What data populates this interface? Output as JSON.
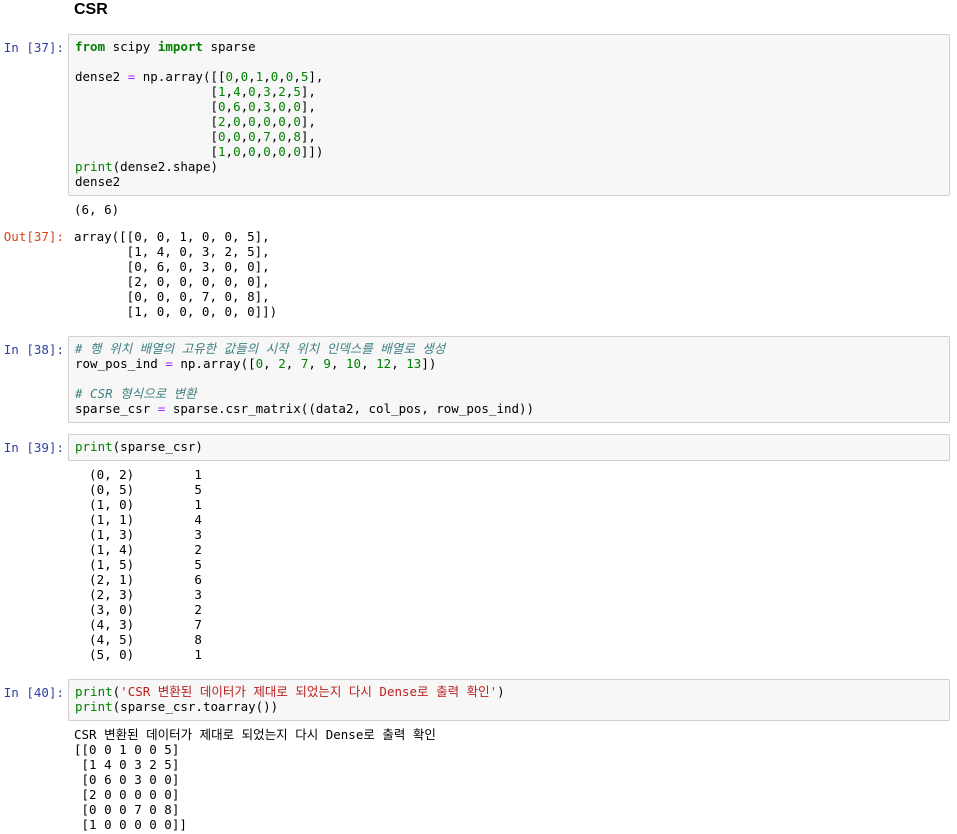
{
  "heading": "CSR",
  "cells": {
    "c37": {
      "in_prompt": "In [37]:",
      "out_prompt": "Out[37]:",
      "code": [
        [
          {
            "t": "from",
            "c": "kw"
          },
          {
            "t": " scipy "
          },
          {
            "t": "import",
            "c": "kw"
          },
          {
            "t": " sparse"
          }
        ],
        [
          {
            "t": ""
          }
        ],
        [
          {
            "t": "dense2 "
          },
          {
            "t": "=",
            "c": "op"
          },
          {
            "t": " np.array([["
          },
          {
            "t": "0",
            "c": "num"
          },
          {
            "t": ","
          },
          {
            "t": "0",
            "c": "num"
          },
          {
            "t": ","
          },
          {
            "t": "1",
            "c": "num"
          },
          {
            "t": ","
          },
          {
            "t": "0",
            "c": "num"
          },
          {
            "t": ","
          },
          {
            "t": "0",
            "c": "num"
          },
          {
            "t": ","
          },
          {
            "t": "5",
            "c": "num"
          },
          {
            "t": "],"
          }
        ],
        [
          {
            "t": "                  ["
          },
          {
            "t": "1",
            "c": "num"
          },
          {
            "t": ","
          },
          {
            "t": "4",
            "c": "num"
          },
          {
            "t": ","
          },
          {
            "t": "0",
            "c": "num"
          },
          {
            "t": ","
          },
          {
            "t": "3",
            "c": "num"
          },
          {
            "t": ","
          },
          {
            "t": "2",
            "c": "num"
          },
          {
            "t": ","
          },
          {
            "t": "5",
            "c": "num"
          },
          {
            "t": "],"
          }
        ],
        [
          {
            "t": "                  ["
          },
          {
            "t": "0",
            "c": "num"
          },
          {
            "t": ","
          },
          {
            "t": "6",
            "c": "num"
          },
          {
            "t": ","
          },
          {
            "t": "0",
            "c": "num"
          },
          {
            "t": ","
          },
          {
            "t": "3",
            "c": "num"
          },
          {
            "t": ","
          },
          {
            "t": "0",
            "c": "num"
          },
          {
            "t": ","
          },
          {
            "t": "0",
            "c": "num"
          },
          {
            "t": "],"
          }
        ],
        [
          {
            "t": "                  ["
          },
          {
            "t": "2",
            "c": "num"
          },
          {
            "t": ","
          },
          {
            "t": "0",
            "c": "num"
          },
          {
            "t": ","
          },
          {
            "t": "0",
            "c": "num"
          },
          {
            "t": ","
          },
          {
            "t": "0",
            "c": "num"
          },
          {
            "t": ","
          },
          {
            "t": "0",
            "c": "num"
          },
          {
            "t": ","
          },
          {
            "t": "0",
            "c": "num"
          },
          {
            "t": "],"
          }
        ],
        [
          {
            "t": "                  ["
          },
          {
            "t": "0",
            "c": "num"
          },
          {
            "t": ","
          },
          {
            "t": "0",
            "c": "num"
          },
          {
            "t": ","
          },
          {
            "t": "0",
            "c": "num"
          },
          {
            "t": ","
          },
          {
            "t": "7",
            "c": "num"
          },
          {
            "t": ","
          },
          {
            "t": "0",
            "c": "num"
          },
          {
            "t": ","
          },
          {
            "t": "8",
            "c": "num"
          },
          {
            "t": "],"
          }
        ],
        [
          {
            "t": "                  ["
          },
          {
            "t": "1",
            "c": "num"
          },
          {
            "t": ","
          },
          {
            "t": "0",
            "c": "num"
          },
          {
            "t": ","
          },
          {
            "t": "0",
            "c": "num"
          },
          {
            "t": ","
          },
          {
            "t": "0",
            "c": "num"
          },
          {
            "t": ","
          },
          {
            "t": "0",
            "c": "num"
          },
          {
            "t": ","
          },
          {
            "t": "0",
            "c": "num"
          },
          {
            "t": "]])"
          }
        ],
        [
          {
            "t": "print",
            "c": "bi"
          },
          {
            "t": "(dense2.shape)"
          }
        ],
        [
          {
            "t": "dense2"
          }
        ]
      ],
      "stdout": "(6, 6)",
      "out_lines": [
        "array([[0, 0, 1, 0, 0, 5],",
        "       [1, 4, 0, 3, 2, 5],",
        "       [0, 6, 0, 3, 0, 0],",
        "       [2, 0, 0, 0, 0, 0],",
        "       [0, 0, 0, 7, 0, 8],",
        "       [1, 0, 0, 0, 0, 0]])"
      ]
    },
    "c38": {
      "in_prompt": "In [38]:",
      "code": [
        [
          {
            "t": "# 행 위치 배열의 고유한 값들의 시작 위치 인덱스를 배열로 생성",
            "c": "cm"
          }
        ],
        [
          {
            "t": "row_pos_ind "
          },
          {
            "t": "=",
            "c": "op"
          },
          {
            "t": " np.array(["
          },
          {
            "t": "0",
            "c": "num"
          },
          {
            "t": ", "
          },
          {
            "t": "2",
            "c": "num"
          },
          {
            "t": ", "
          },
          {
            "t": "7",
            "c": "num"
          },
          {
            "t": ", "
          },
          {
            "t": "9",
            "c": "num"
          },
          {
            "t": ", "
          },
          {
            "t": "10",
            "c": "num"
          },
          {
            "t": ", "
          },
          {
            "t": "12",
            "c": "num"
          },
          {
            "t": ", "
          },
          {
            "t": "13",
            "c": "num"
          },
          {
            "t": "])"
          }
        ],
        [
          {
            "t": ""
          }
        ],
        [
          {
            "t": "# CSR 형식으로 변환",
            "c": "cm"
          }
        ],
        [
          {
            "t": "sparse_csr "
          },
          {
            "t": "=",
            "c": "op"
          },
          {
            "t": " sparse.csr_matrix((data2, col_pos, row_pos_ind))"
          }
        ]
      ]
    },
    "c39": {
      "in_prompt": "In [39]:",
      "code": [
        [
          {
            "t": "print",
            "c": "bi"
          },
          {
            "t": "(sparse_csr)"
          }
        ]
      ],
      "out_lines": [
        "  (0, 2)\t1",
        "  (0, 5)\t5",
        "  (1, 0)\t1",
        "  (1, 1)\t4",
        "  (1, 3)\t3",
        "  (1, 4)\t2",
        "  (1, 5)\t5",
        "  (2, 1)\t6",
        "  (2, 3)\t3",
        "  (3, 0)\t2",
        "  (4, 3)\t7",
        "  (4, 5)\t8",
        "  (5, 0)\t1"
      ]
    },
    "c40": {
      "in_prompt": "In [40]:",
      "code": [
        [
          {
            "t": "print",
            "c": "bi"
          },
          {
            "t": "("
          },
          {
            "t": "'CSR 변환된 데이터가 제대로 되었는지 다시 Dense로 출력 확인'",
            "c": "str"
          },
          {
            "t": ")"
          }
        ],
        [
          {
            "t": "print",
            "c": "bi"
          },
          {
            "t": "(sparse_csr.toarray())"
          }
        ]
      ],
      "out_lines": [
        "CSR 변환된 데이터가 제대로 되었는지 다시 Dense로 출력 확인",
        "[[0 0 1 0 0 5]",
        " [1 4 0 3 2 5]",
        " [0 6 0 3 0 0]",
        " [2 0 0 0 0 0]",
        " [0 0 0 7 0 8]",
        " [1 0 0 0 0 0]]"
      ]
    }
  }
}
